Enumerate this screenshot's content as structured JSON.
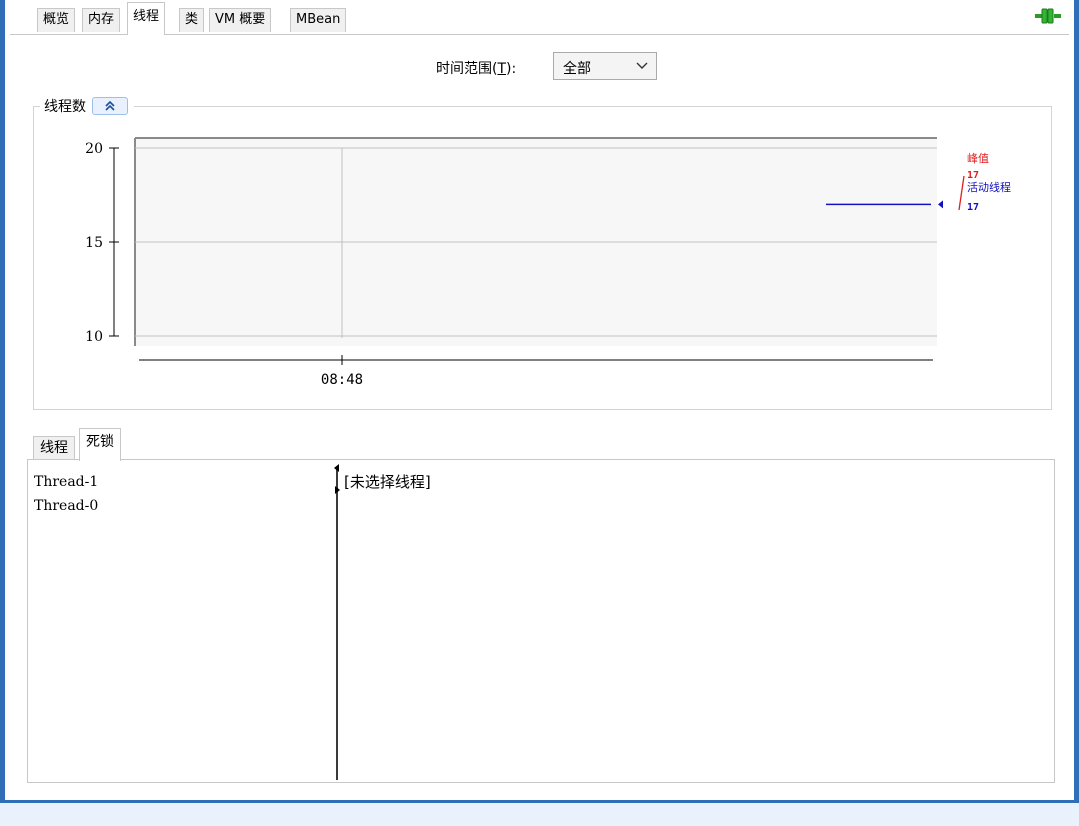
{
  "tabs": [
    {
      "label": "概览"
    },
    {
      "label": "内存"
    },
    {
      "label": "线程"
    },
    {
      "label": "类"
    },
    {
      "label": "VM 概要"
    },
    {
      "label": "MBean"
    }
  ],
  "time_range": {
    "label_pre": "时间范围(",
    "label_key": "T",
    "label_post": "):",
    "selected": "全部"
  },
  "chart_group": {
    "title": "线程数"
  },
  "chart_data": {
    "type": "line",
    "x_tick_labels": [
      "08:48"
    ],
    "y_ticks": [
      10,
      15,
      20
    ],
    "ylim": [
      10,
      20
    ],
    "grid": true,
    "series": [
      {
        "name": "峰值",
        "value_label": "17",
        "color": "#e02020",
        "values": [
          17
        ]
      },
      {
        "name": "活动线程",
        "value_label": "17",
        "color": "#1010c0",
        "values": [
          17
        ]
      }
    ]
  },
  "subtabs": [
    {
      "label": "线程"
    },
    {
      "label": "死锁"
    }
  ],
  "threads": [
    "Thread-1",
    "Thread-0"
  ],
  "detail": {
    "placeholder": "[未选择线程]"
  },
  "colors": {
    "frame": "#2e6fb5",
    "active_line": "#1010c0",
    "peak": "#e02020"
  }
}
